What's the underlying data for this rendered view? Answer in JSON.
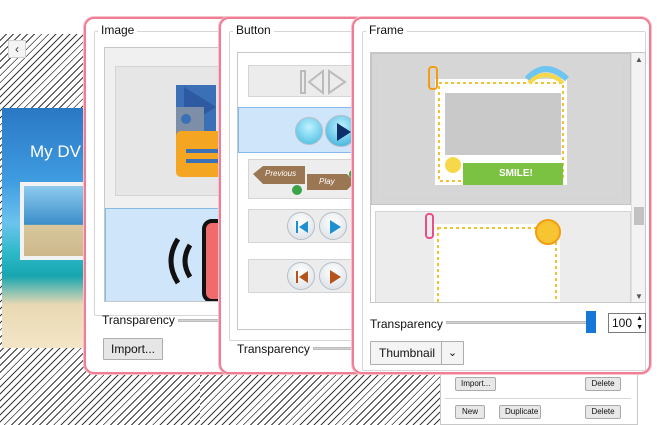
{
  "background_editor": {
    "back_glyph": "‹",
    "dvd_title": "My DV",
    "dialog": {
      "import_label": "Import...",
      "delete_label": "Delete",
      "new_label": "New",
      "duplicate_label": "Duplicate",
      "delete2_label": "Delete"
    }
  },
  "image_panel": {
    "title": "Image",
    "transparency_label": "Transparency",
    "import_label": "Import..."
  },
  "button_panel": {
    "title": "Button",
    "transparency_label": "Transparency",
    "styles": [
      {
        "prev": "Previous",
        "play": "Play"
      }
    ]
  },
  "frame_panel": {
    "title": "Frame",
    "transparency_label": "Transparency",
    "transparency_value": "100",
    "transparency_fraction": 1.0,
    "view_select": "Thumbnail",
    "smile_text": "SMILE!"
  },
  "colors": {
    "panel_border": "#ef7d93",
    "selection": "#cfe5fa",
    "slider_thumb": "#1577d6"
  }
}
